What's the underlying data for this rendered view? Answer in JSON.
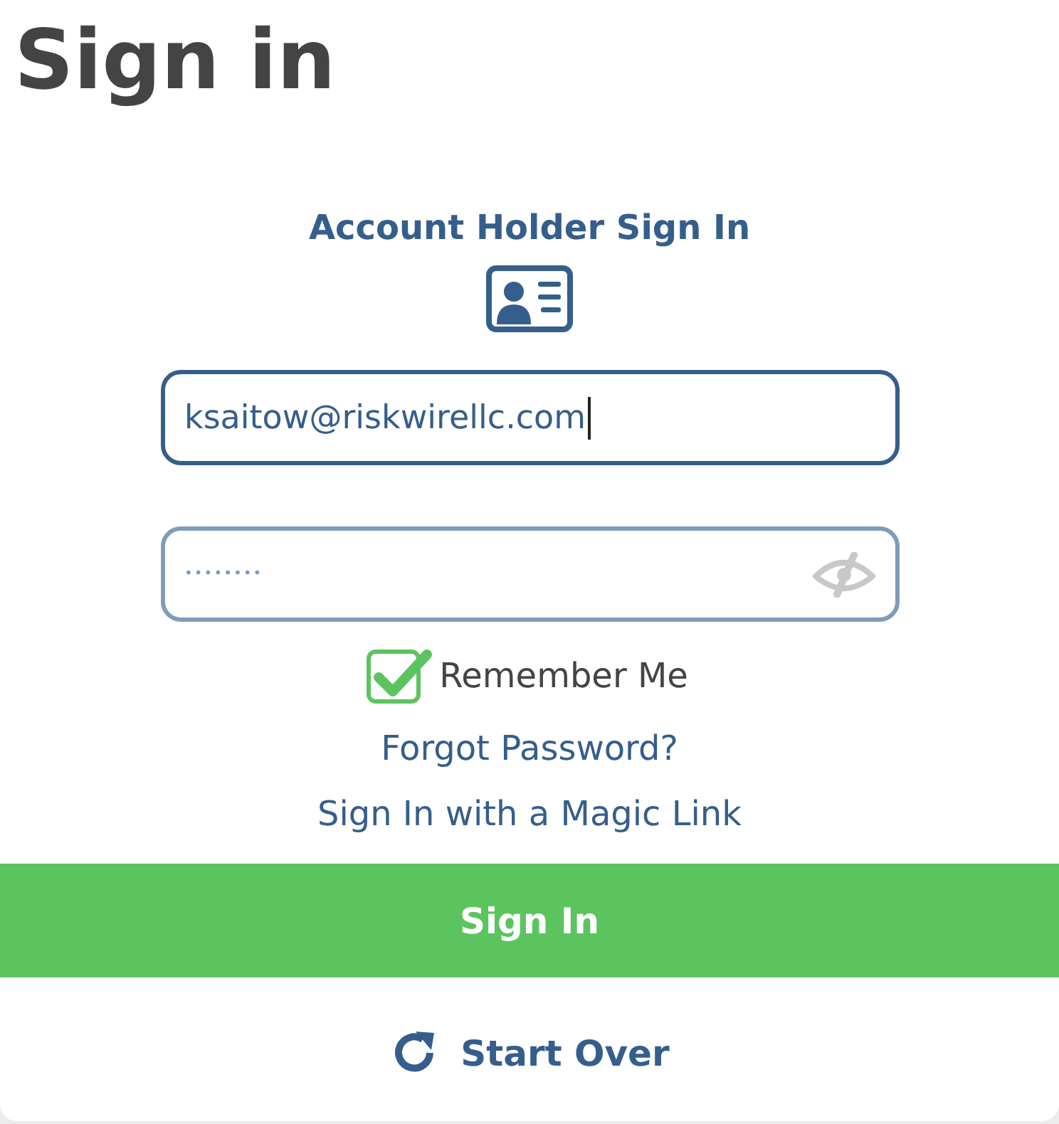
{
  "page_title": "Sign in",
  "section_title": "Account Holder Sign In",
  "email_field": {
    "value": "ksaitow@riskwirellc.com",
    "focused": true
  },
  "password_field": {
    "value": "••••••••"
  },
  "remember_me": {
    "label": "Remember Me",
    "checked": true
  },
  "links": [
    "Forgot Password?",
    "Sign In with a Magic Link"
  ],
  "sign_in_button": "Sign In",
  "start_over_button": "Start Over"
}
